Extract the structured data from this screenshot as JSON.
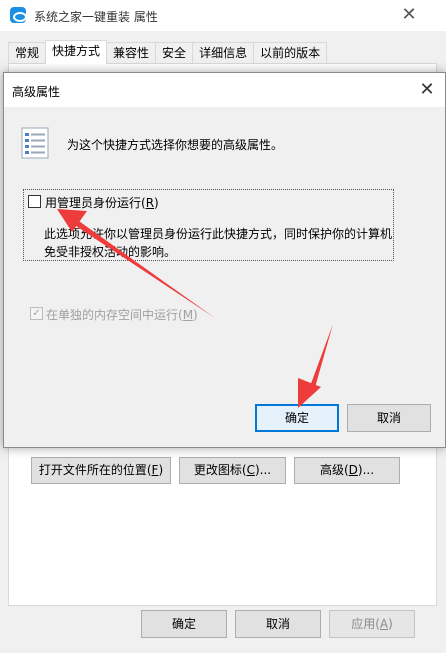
{
  "background_window": {
    "title": "系统之家一键重装 属性",
    "close_glyph": "✕",
    "tabs": [
      {
        "label": "常规"
      },
      {
        "label": "快捷方式"
      },
      {
        "label": "兼容性"
      },
      {
        "label": "安全"
      },
      {
        "label": "详细信息"
      },
      {
        "label": "以前的版本"
      }
    ],
    "active_tab": "快捷方式",
    "buttons": {
      "open_location": {
        "text": "打开文件所在的位置(",
        "key": "F",
        "end": ")"
      },
      "change_icon": {
        "text": "更改图标(",
        "key": "C",
        "end": ")..."
      },
      "advanced": {
        "text": "高级(",
        "key": "D",
        "end": ")..."
      },
      "ok": "确定",
      "cancel": "取消",
      "apply": {
        "text": "应用(",
        "key": "A",
        "end": ")"
      }
    }
  },
  "advanced_dialog": {
    "title": "高级属性",
    "close_glyph": "✕",
    "description": "为这个快捷方式选择你想要的高级属性。",
    "run_as_admin": {
      "text": "用管理员身份运行(",
      "key": "R",
      "end": ")",
      "checked": false
    },
    "admin_explanation": "此选项允许你以管理员身份运行此快捷方式，同时保护你的计算机免受非授权活动的影响。",
    "separate_memory": {
      "text": "在单独的内存空间中运行(",
      "key": "M",
      "end": ")",
      "checked": true,
      "enabled": false
    },
    "ok_button": "确定",
    "cancel_button": "取消"
  },
  "colors": {
    "accent": "#0078d7",
    "annotation_arrow": "#ee3b3b",
    "window_bg": "#f0f0f0"
  }
}
